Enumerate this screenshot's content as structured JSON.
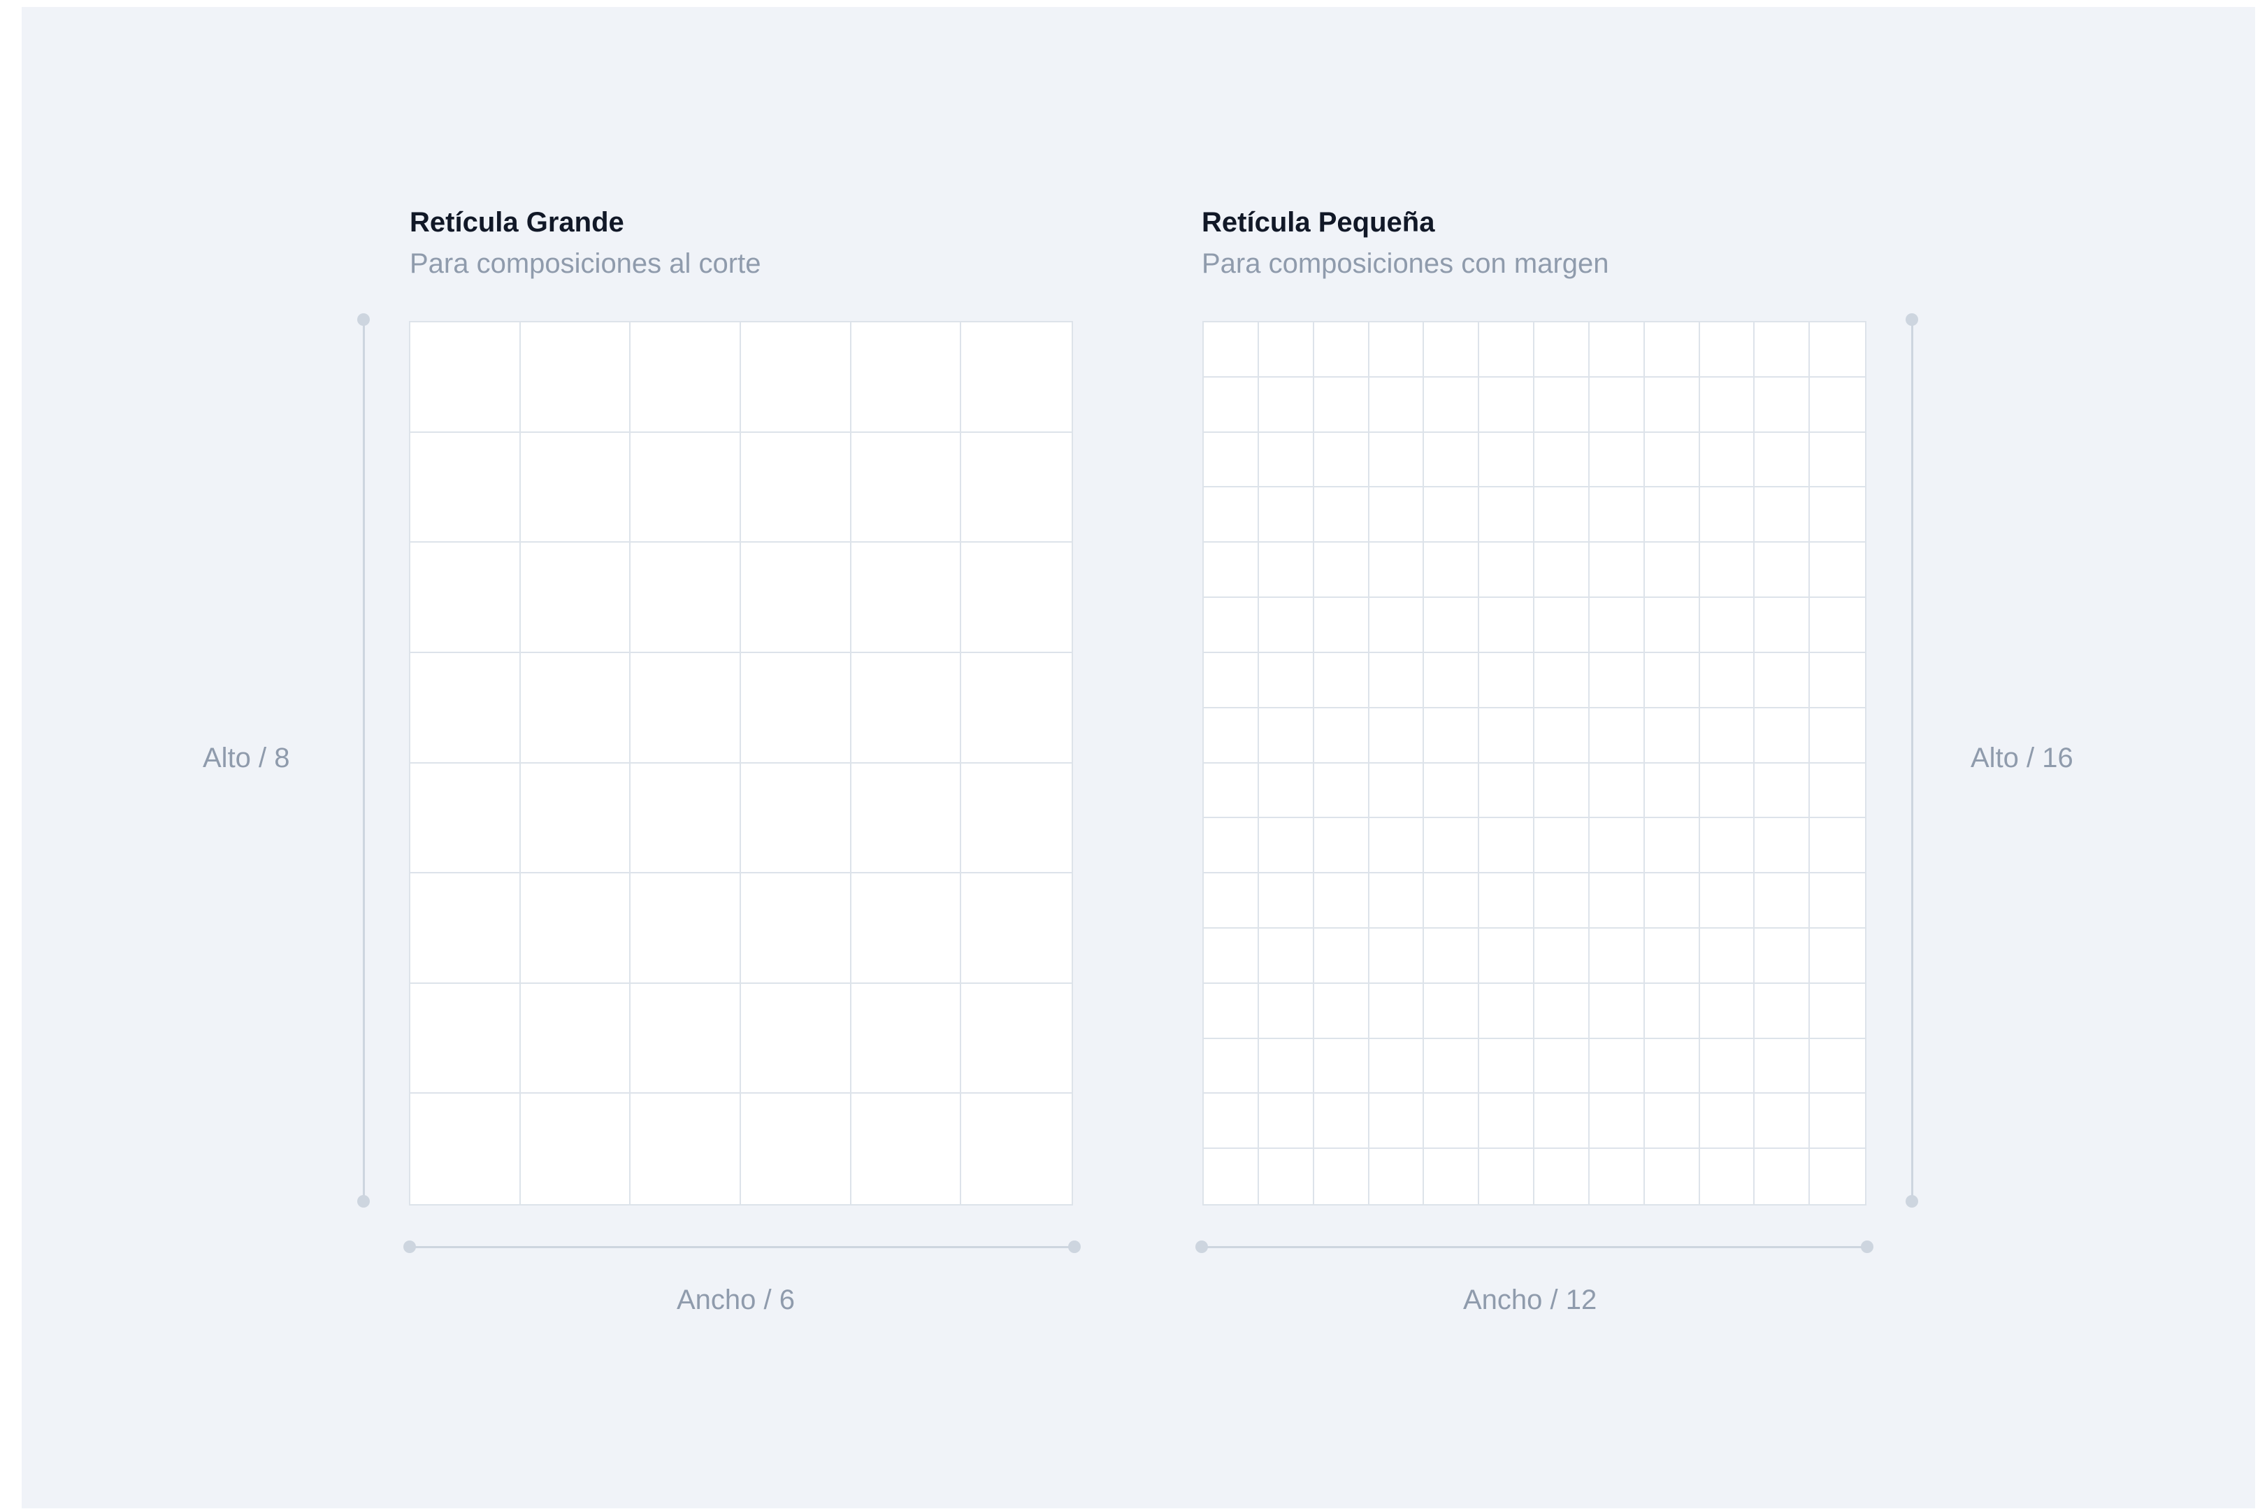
{
  "large_grid": {
    "title": "Retícula Grande",
    "subtitle": "Para composiciones al corte",
    "columns": 6,
    "rows": 8,
    "width_label": "Ancho / 6",
    "height_label": "Alto / 8"
  },
  "small_grid": {
    "title": "Retícula Pequeña",
    "subtitle": "Para composiciones con margen",
    "columns": 12,
    "rows": 16,
    "width_label": "Ancho / 12",
    "height_label": "Alto / 16"
  },
  "colors": {
    "background": "#f0f3f8",
    "grid_line": "#dde3ea",
    "ruler": "#cdd5df",
    "title": "#111827",
    "muted_text": "#8f9bac"
  }
}
